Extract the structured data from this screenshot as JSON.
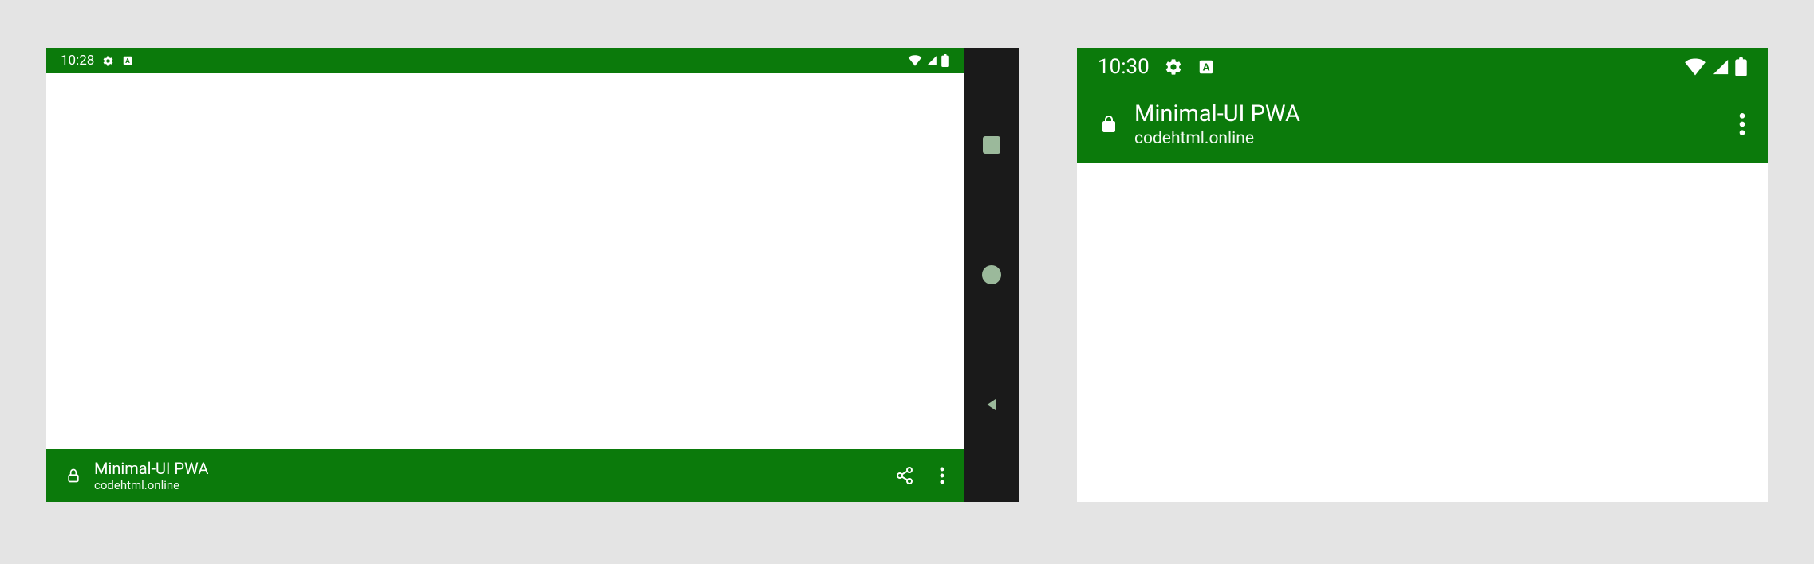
{
  "left": {
    "status": {
      "time": "10:28"
    },
    "app_bar": {
      "title": "Minimal-UI PWA",
      "domain": "codehtml.online"
    }
  },
  "right": {
    "status": {
      "time": "10:30"
    },
    "app_bar": {
      "title": "Minimal-UI PWA",
      "domain": "codehtml.online"
    }
  },
  "colors": {
    "accent": "#0b7a0b",
    "nav_bg": "#1a1a1a",
    "nav_icon": "#9bb99b",
    "page_bg": "#e4e4e4"
  }
}
